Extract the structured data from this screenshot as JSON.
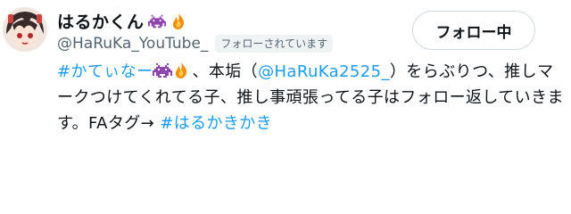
{
  "profile": {
    "display_name": "はるかくん",
    "handle": "@HaRuKa_YouTube_",
    "follows_you_badge": "フォローされています",
    "follow_button_label": "フォロー中"
  },
  "bio": {
    "hashtag1": "#かてぃなー",
    "text1": "、本垢（",
    "mention": "@HaRuKa2525_",
    "text2": "）をらぶりつ、推しマークつけてくれてる子、推し事頑張ってる子はフォロー返していきます。FAタグ→ ",
    "hashtag2": "#はるかきかき"
  },
  "icons": [
    "space-invader-icon",
    "fire-icon"
  ],
  "colors": {
    "link": "#1d9bf0",
    "muted": "#536471",
    "text": "#0f1419"
  }
}
